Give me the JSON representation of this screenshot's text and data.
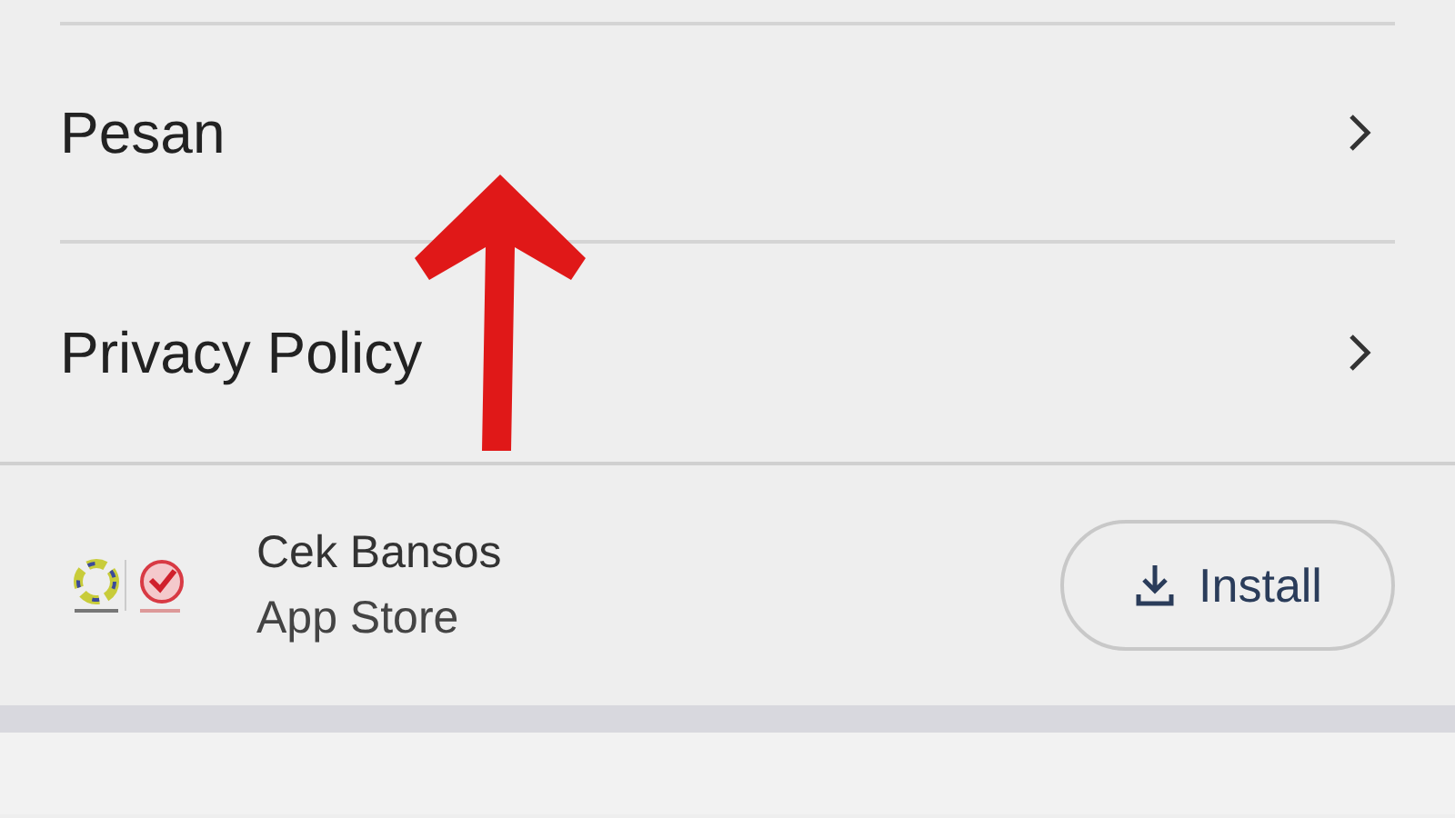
{
  "menu_items": [
    {
      "label": "Pesan"
    },
    {
      "label": "Privacy Policy"
    }
  ],
  "app_promo": {
    "name": "Cek Bansos",
    "source": "App Store",
    "button": "Install"
  }
}
